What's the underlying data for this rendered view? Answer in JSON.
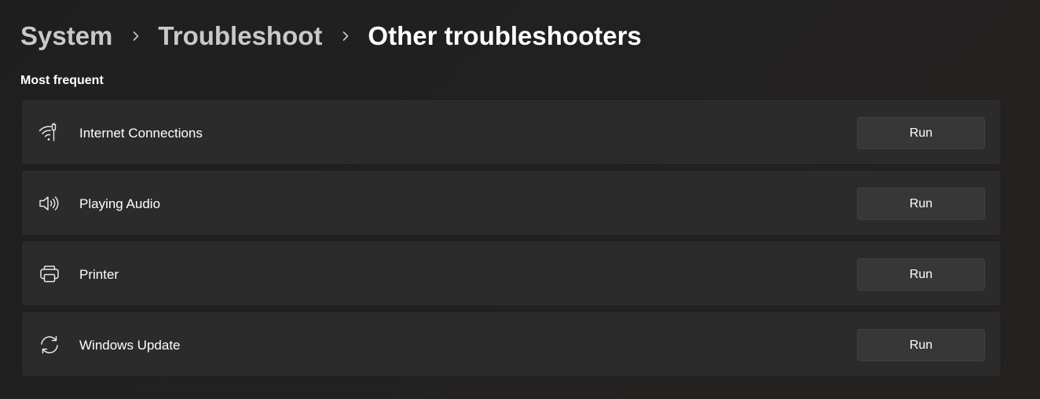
{
  "breadcrumb": {
    "items": [
      {
        "label": "System"
      },
      {
        "label": "Troubleshoot"
      },
      {
        "label": "Other troubleshooters"
      }
    ]
  },
  "section": {
    "title": "Most frequent"
  },
  "troubleshooters": [
    {
      "label": "Internet Connections",
      "icon": "wifi-icon",
      "button": "Run"
    },
    {
      "label": "Playing Audio",
      "icon": "speaker-icon",
      "button": "Run"
    },
    {
      "label": "Printer",
      "icon": "printer-icon",
      "button": "Run"
    },
    {
      "label": "Windows Update",
      "icon": "sync-icon",
      "button": "Run"
    }
  ],
  "colors": {
    "background": "#202020",
    "card": "#2b2b2b",
    "button": "#373737",
    "text": "#ffffff",
    "breadcrumb_parent": "#c9c9c9"
  }
}
